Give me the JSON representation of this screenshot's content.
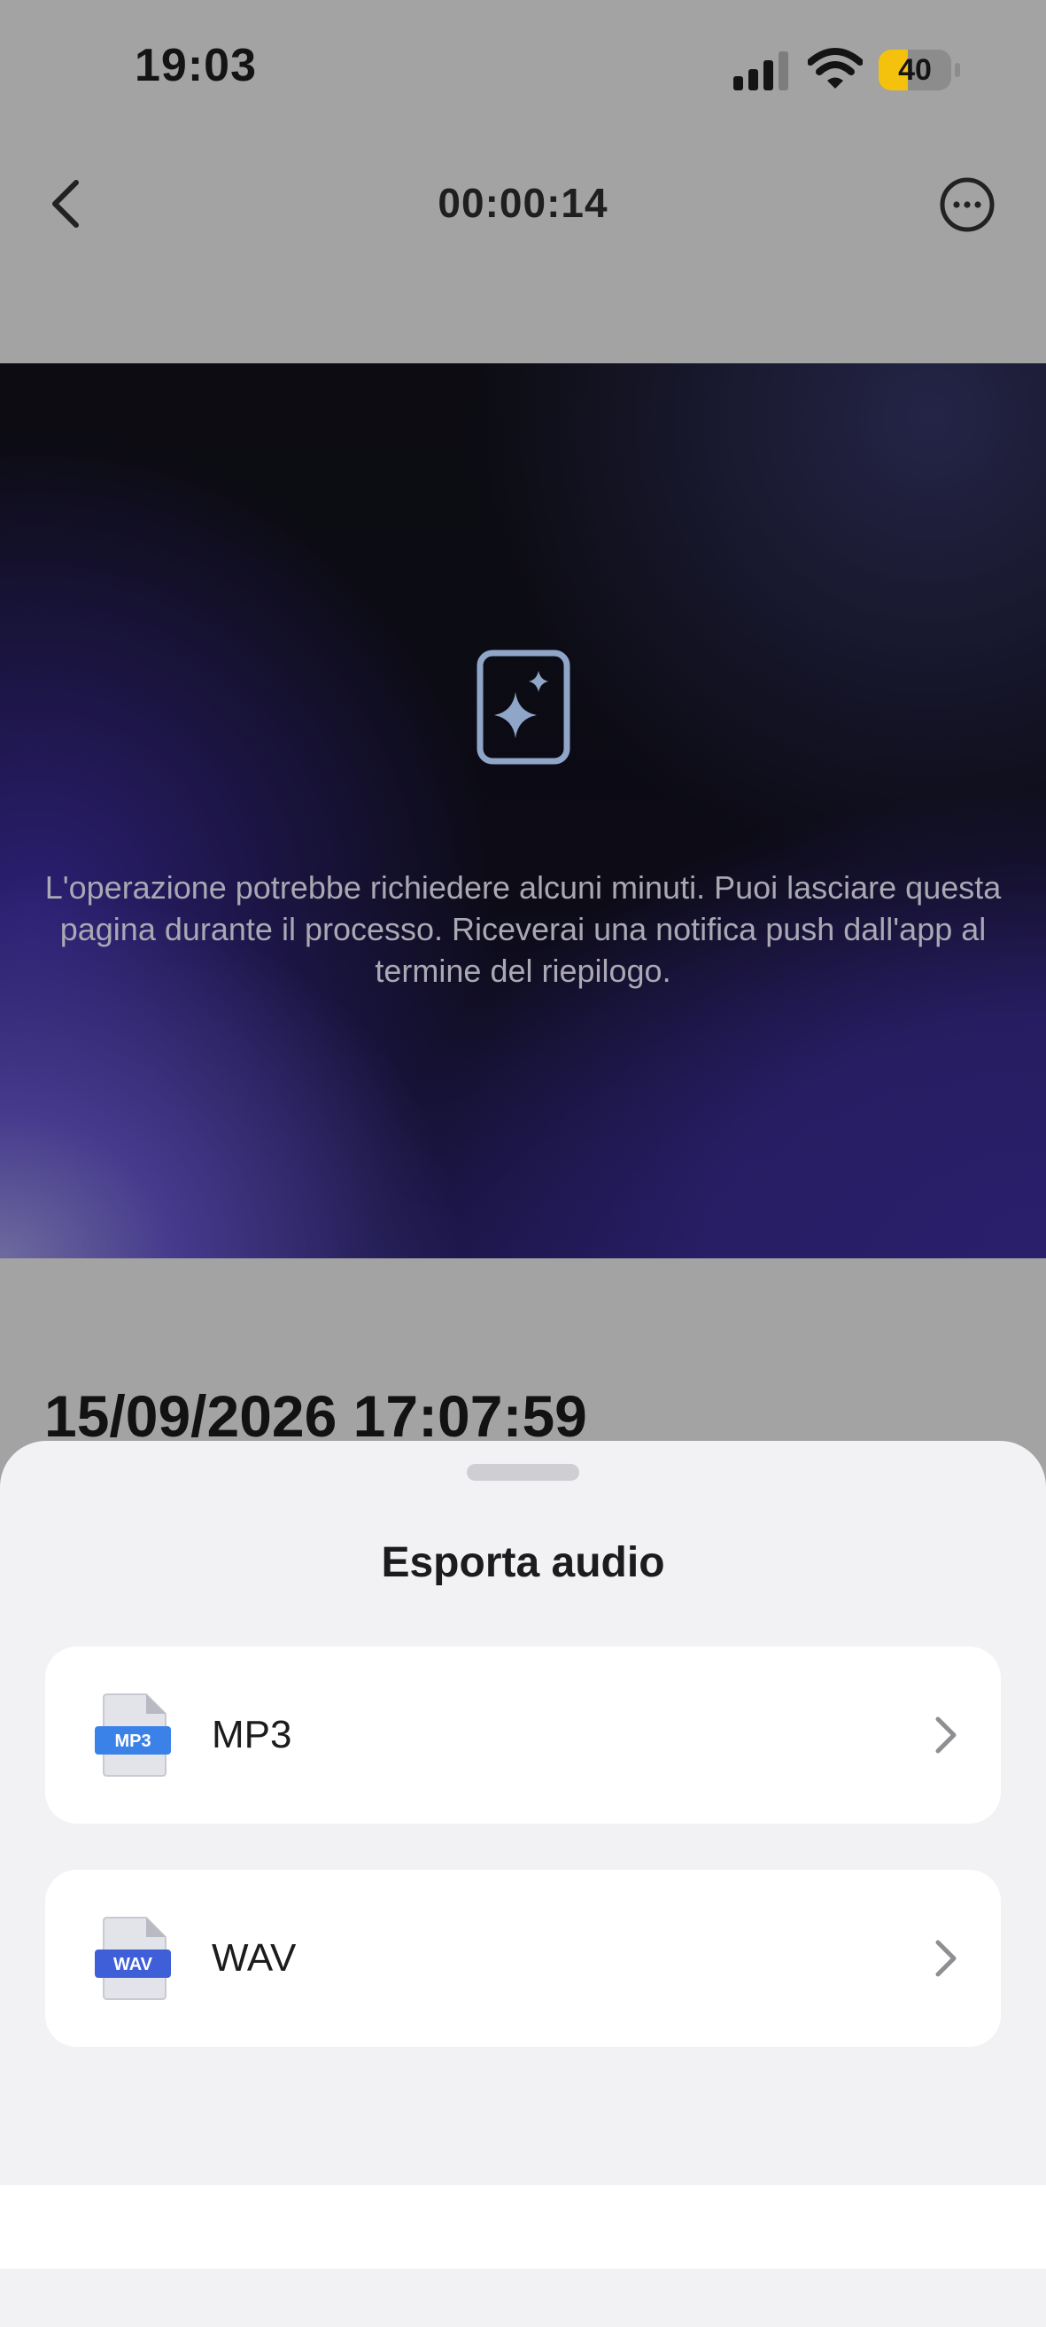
{
  "status_bar": {
    "time": "19:03",
    "battery": "40",
    "battery_level_fraction": 0.4
  },
  "nav": {
    "title": "00:00:14"
  },
  "hero": {
    "message": "L'operazione potrebbe richiedere alcuni minuti. Puoi lasciare questa pagina durante il processo. Riceverai una notifica push dall'app al termine del riepilogo."
  },
  "recording": {
    "date": "15/09/2026 17:07:59"
  },
  "sheet": {
    "title": "Esporta audio",
    "options": [
      {
        "label": "MP3",
        "badge": "MP3",
        "badge_color": "#3b82e8"
      },
      {
        "label": "WAV",
        "badge": "WAV",
        "badge_color": "#3f5fd8"
      }
    ]
  },
  "colors": {
    "accent_mp3": "#3b82e8",
    "accent_wav": "#3f5fd8",
    "battery": "#f4c20d"
  }
}
